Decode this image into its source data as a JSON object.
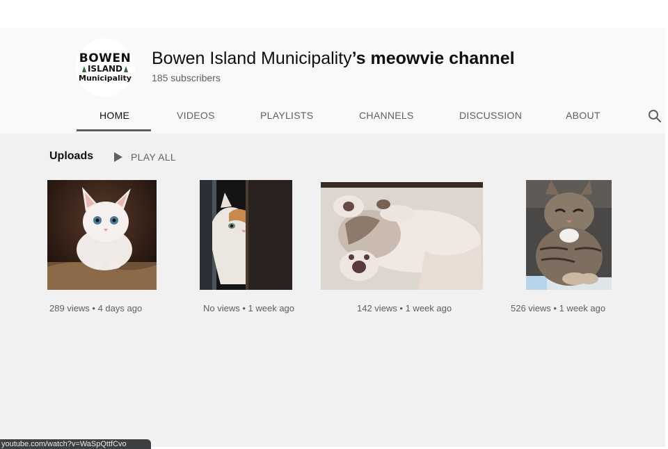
{
  "channel": {
    "logo": {
      "line1": "BOWEN",
      "line2": "ISLAND",
      "line3": "Municipality"
    },
    "title_regular": "Bowen Island Municipality",
    "title_bold": "’s meowvie channel",
    "subscribers": "185 subscribers"
  },
  "tabs": [
    {
      "label": "HOME",
      "active": true
    },
    {
      "label": "VIDEOS"
    },
    {
      "label": "PLAYLISTS"
    },
    {
      "label": "CHANNELS"
    },
    {
      "label": "DISCUSSION"
    },
    {
      "label": "ABOUT"
    }
  ],
  "search_icon": "search-icon",
  "uploads": {
    "title": "Uploads",
    "play_all": "PLAY ALL"
  },
  "videos": [
    {
      "meta": "289 views • 4 days ago"
    },
    {
      "meta": "No views • 1 week ago"
    },
    {
      "meta": "142 views • 1 week ago"
    },
    {
      "meta": "526 views • 1 week ago"
    }
  ],
  "status_bar": {
    "url": "youtube.com/watch?v=WaSpQttfCvo"
  },
  "colors": {
    "accent_text": "#0f0f0f",
    "muted_text": "#606060",
    "header_bg": "#f9f9f9",
    "content_bg": "#f1f1f1"
  }
}
